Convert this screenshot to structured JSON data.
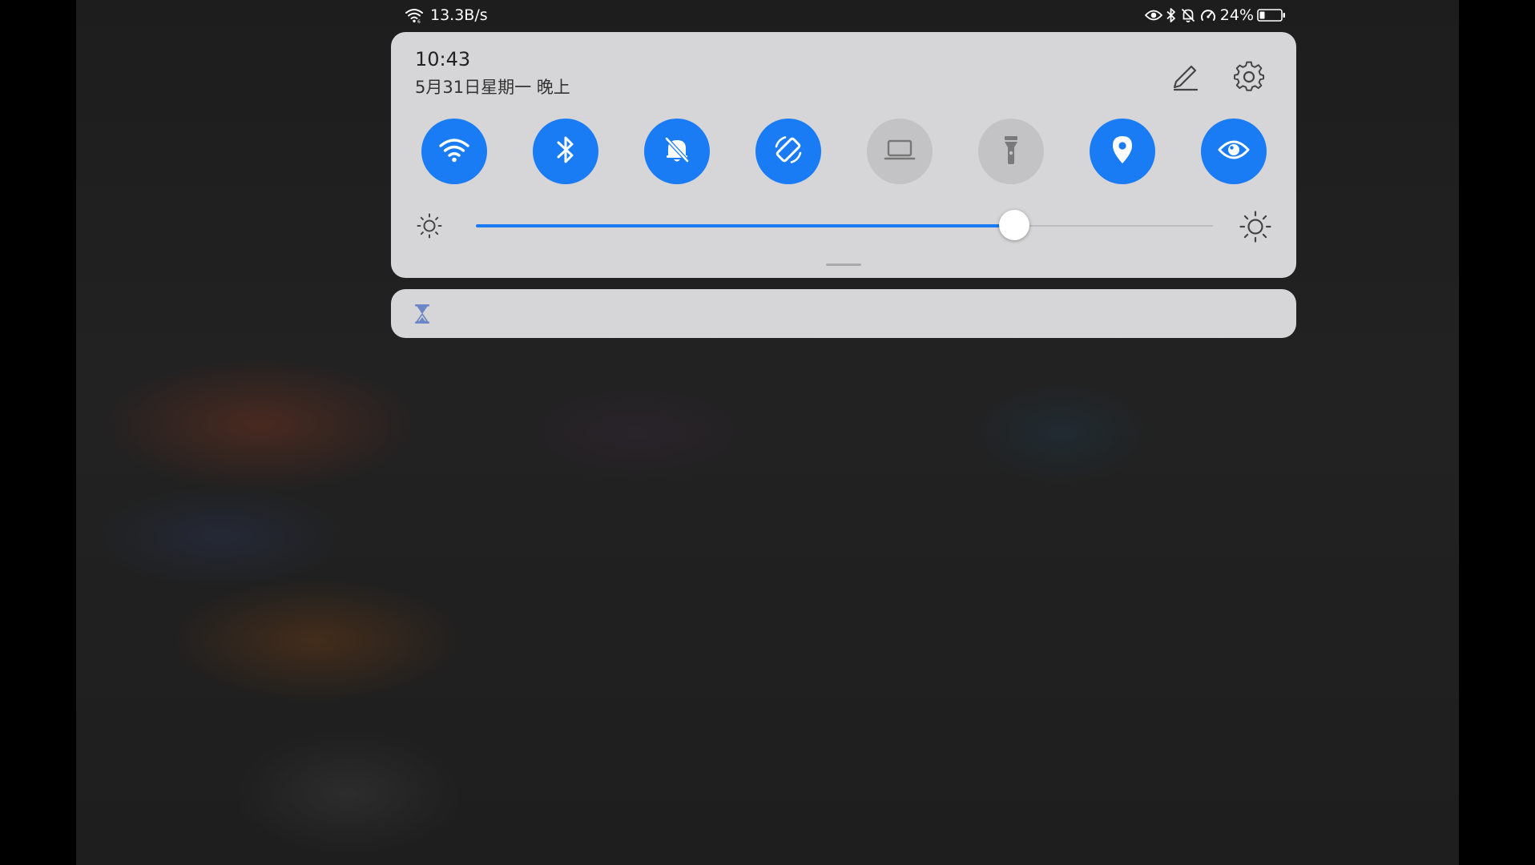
{
  "status_bar": {
    "network_speed": "13.3B/s",
    "battery_percent": "24%",
    "battery_level": 0.24,
    "icons": [
      "wifi-signal-icon",
      "eye-comfort-icon",
      "bluetooth-icon",
      "bell-muted-icon",
      "speedometer-icon",
      "battery-icon"
    ]
  },
  "panel": {
    "time": "10:43",
    "date": "5月31日星期一 晚上",
    "toggles": [
      {
        "icon": "wifi-icon",
        "active": true
      },
      {
        "icon": "bluetooth-icon",
        "active": true
      },
      {
        "icon": "bell-muted-icon",
        "active": true
      },
      {
        "icon": "auto-rotate-icon",
        "active": true
      },
      {
        "icon": "laptop-icon",
        "active": false
      },
      {
        "icon": "flashlight-icon",
        "active": false
      },
      {
        "icon": "location-icon",
        "active": true
      },
      {
        "icon": "eye-comfort-icon",
        "active": true
      }
    ],
    "brightness": 0.73
  },
  "colors": {
    "accent": "#1a7cf5",
    "panel_bg": "#d6d5d7",
    "inactive_toggle": "#c3c3c5"
  },
  "notification": {
    "icon": "hourglass-icon"
  }
}
